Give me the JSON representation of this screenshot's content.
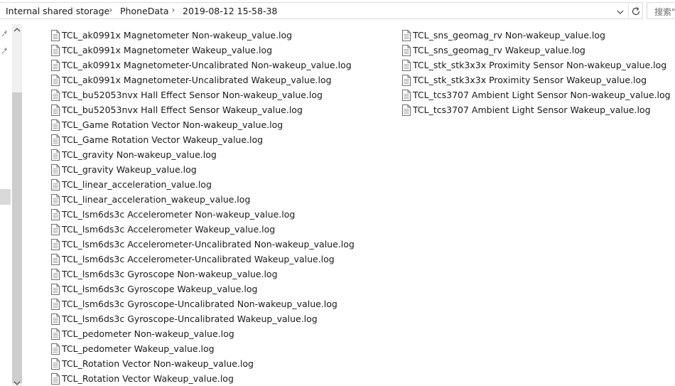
{
  "address_bar": {
    "breadcrumbs": [
      "Internal shared storage",
      "PhoneData",
      "2019-08-12 15-58-38"
    ],
    "dropdown_icon": "chevron-down-icon",
    "refresh_icon": "refresh-icon",
    "search_placeholder": "搜索\""
  },
  "left_nav": {
    "pinned_icon": "pin-icon"
  },
  "files": {
    "column1": [
      "TCL_ak0991x Magnetometer Non-wakeup_value.log",
      "TCL_ak0991x Magnetometer Wakeup_value.log",
      "TCL_ak0991x Magnetometer-Uncalibrated Non-wakeup_value.log",
      "TCL_ak0991x Magnetometer-Uncalibrated Wakeup_value.log",
      "TCL_bu52053nvx Hall Effect Sensor Non-wakeup_value.log",
      "TCL_bu52053nvx Hall Effect Sensor Wakeup_value.log",
      "TCL_Game Rotation Vector  Non-wakeup_value.log",
      "TCL_Game Rotation Vector  Wakeup_value.log",
      "TCL_gravity  Non-wakeup_value.log",
      "TCL_gravity  Wakeup_value.log",
      "TCL_linear_acceleration_value.log",
      "TCL_linear_acceleration_wakeup_value.log",
      "TCL_lsm6ds3c Accelerometer Non-wakeup_value.log",
      "TCL_lsm6ds3c Accelerometer Wakeup_value.log",
      "TCL_lsm6ds3c Accelerometer-Uncalibrated Non-wakeup_value.log",
      "TCL_lsm6ds3c Accelerometer-Uncalibrated Wakeup_value.log",
      "TCL_lsm6ds3c Gyroscope Non-wakeup_value.log",
      "TCL_lsm6ds3c Gyroscope Wakeup_value.log",
      "TCL_lsm6ds3c Gyroscope-Uncalibrated Non-wakeup_value.log",
      "TCL_lsm6ds3c Gyroscope-Uncalibrated Wakeup_value.log",
      "TCL_pedometer  Non-wakeup_value.log",
      "TCL_pedometer  Wakeup_value.log",
      "TCL_Rotation Vector  Non-wakeup_value.log",
      "TCL_Rotation Vector  Wakeup_value.log"
    ],
    "column2": [
      "TCL_sns_geomag_rv  Non-wakeup_value.log",
      "TCL_sns_geomag_rv  Wakeup_value.log",
      "TCL_stk_stk3x3x Proximity Sensor Non-wakeup_value.log",
      "TCL_stk_stk3x3x Proximity Sensor Wakeup_value.log",
      "TCL_tcs3707 Ambient Light Sensor Non-wakeup_value.log",
      "TCL_tcs3707 Ambient Light Sensor Wakeup_value.log"
    ],
    "icon": "text-file-icon"
  }
}
